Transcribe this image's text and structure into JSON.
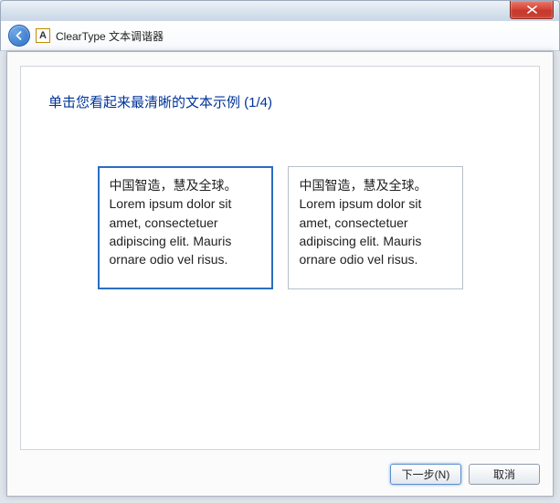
{
  "titlebar": {
    "close_glyph": "✕"
  },
  "header": {
    "app_icon_letter": "A",
    "title": "ClearType 文本调谐器"
  },
  "main": {
    "heading": "单击您看起来最清晰的文本示例 (1/4)",
    "samples": [
      {
        "selected": true,
        "line_cjk": "中国智造，慧及全球。",
        "line_latin": "Lorem ipsum dolor sit amet, consectetuer adipiscing elit. Mauris ornare odio vel risus."
      },
      {
        "selected": false,
        "line_cjk": "中国智造，慧及全球。",
        "line_latin": "Lorem ipsum dolor sit amet, consectetuer adipiscing elit. Mauris ornare odio vel risus."
      }
    ]
  },
  "footer": {
    "next_label": "下一步(N)",
    "cancel_label": "取消"
  }
}
